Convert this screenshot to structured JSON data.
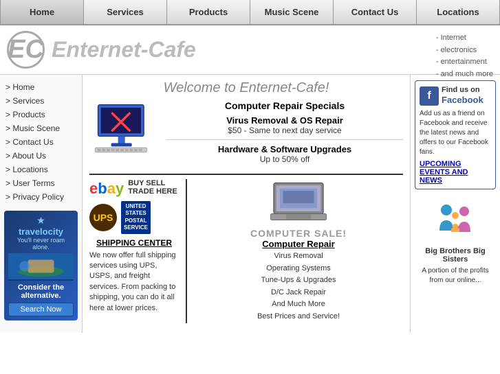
{
  "nav": {
    "items": [
      "Home",
      "Services",
      "Products",
      "Music Scene",
      "Contact Us",
      "Locations"
    ]
  },
  "logo": {
    "ec": "EC",
    "name": "Enternet-Cafe",
    "links": [
      "- Internet",
      "- electronics",
      "- entertainment",
      "- and much more"
    ]
  },
  "sidebar": {
    "links": [
      "Home",
      "Services",
      "Products",
      "Music Scene",
      "Contact Us",
      "About Us",
      "Locations",
      "User Terms",
      "Privacy Policy"
    ]
  },
  "travelocity": {
    "logo": "travelocity",
    "tagline": "You'll never roam alone.",
    "star": "★",
    "consider": "Consider the alternative.",
    "search_btn": "Search Now"
  },
  "main": {
    "welcome": "Welcome to Enternet-Cafe!",
    "specials_title": "Computer Repair Specials",
    "virus_title": "Virus Removal & OS Repair",
    "virus_desc": "$50 - Same to next day service",
    "hardware_title": "Hardware & Software Upgrades",
    "hardware_desc": "Up to 50% off",
    "buy_sell": "BUY SELL TRADE HERE",
    "shipping_title": "SHIPPING CENTER",
    "shipping_desc": "We now offer full shipping services using UPS, USPS, and freight services. From packing to shipping, you can do it all here at lower prices.",
    "computer_sale": "COMPUTER SALE!",
    "repair_title": "Computer Repair",
    "repair_list": [
      "Virus Removal",
      "Operating Systems",
      "Tune-Ups & Upgrades",
      "D/C Jack Repair",
      "And Much More",
      "Best Prices and Service!"
    ]
  },
  "facebook": {
    "find": "Find us on",
    "platform": "Facebook",
    "desc": "Add us as a friend on Facebook and receive the latest news and offers to our Facebook fans.",
    "events": "UPCOMING EVENTS AND NEWS"
  },
  "bbbs": {
    "title": "Big Brothers Big Sisters",
    "desc": "A portion of the profits from our online..."
  }
}
